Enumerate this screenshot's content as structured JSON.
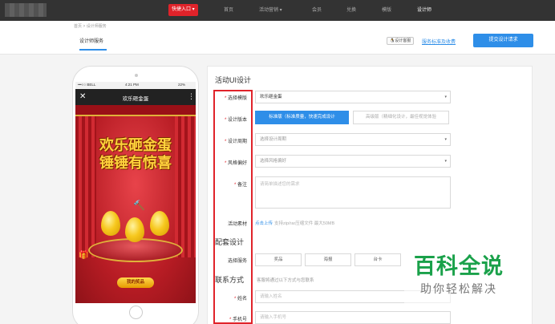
{
  "topnav": {
    "quick_entry": "快捷入口 ▾",
    "items": [
      {
        "label": "首页"
      },
      {
        "label": "活动营销 ▾"
      },
      {
        "label": "会员"
      },
      {
        "label": "兑换"
      },
      {
        "label": "模版"
      },
      {
        "label": "设计师"
      }
    ]
  },
  "subheader": {
    "breadcrumb": "首页 > 设计师服务",
    "tab": "设计师服务",
    "qq_service": "设计客服",
    "standard_link": "服务标准及收费",
    "submit_label": "提交设计请求"
  },
  "phone": {
    "carrier": "•••○○ BELL",
    "time": "4:21 PM",
    "battery": "22%",
    "app_title": "欢乐砸金蛋",
    "headline_1": "欢乐砸金蛋",
    "headline_2": "锤锤有惊喜",
    "prize_button": "我的奖品"
  },
  "form": {
    "section_title": "活动UI设计",
    "template": {
      "label": "选择模版",
      "value": "欢乐砸金蛋"
    },
    "version": {
      "label": "设计版本",
      "standard": "标准版（标准质量，快速完成设计",
      "premium": "高级版（精细化设计，最佳视觉体验"
    },
    "cycle": {
      "label": "设计周期",
      "placeholder": "选择设计周期"
    },
    "style": {
      "label": "风格偏好",
      "placeholder": "选择风格偏好"
    },
    "remark": {
      "label": "备注",
      "placeholder": "请简单描述您的需求"
    },
    "material": {
      "label": "活动素材",
      "upload": "点击上传",
      "hint": "支持zip/rar压缩文件 最大50MB"
    },
    "service_section": "配套设计",
    "service": {
      "label": "选择服务",
      "options": [
        "奖品",
        "海报",
        "台卡"
      ]
    },
    "contact_section": "联系方式",
    "contact_hint": "客服将通过以下方式与您联系",
    "name": {
      "label": "姓名",
      "placeholder": "请输入姓名"
    },
    "phone": {
      "label": "手机号",
      "placeholder": "请输入手机号"
    }
  },
  "watermark": {
    "main": "百科全说",
    "sub": "助你轻松解决"
  }
}
